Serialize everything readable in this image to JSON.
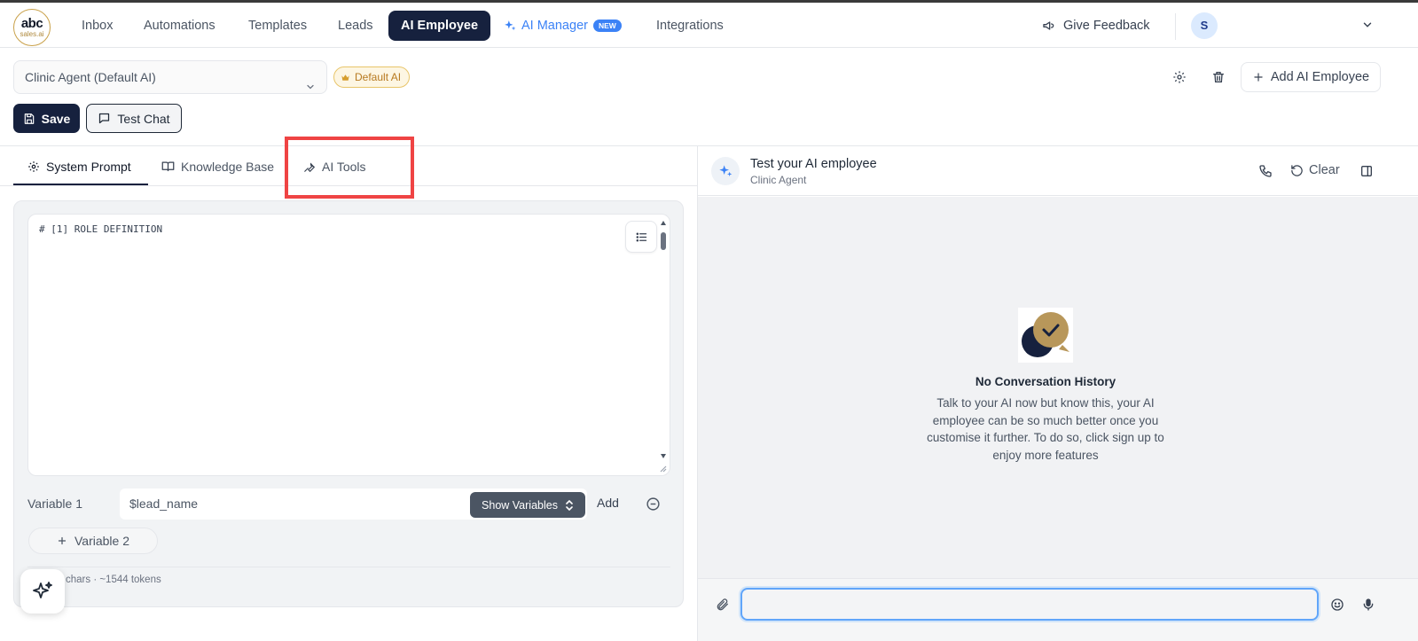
{
  "logo": {
    "main": "abc",
    "sub": "sales.ai"
  },
  "nav": {
    "items": [
      "Inbox",
      "Automations",
      "Templates",
      "Leads",
      "AI Employee",
      "AI Manager",
      "Integrations"
    ],
    "active": "AI Employee",
    "new_badge": "NEW",
    "feedback": "Give Feedback",
    "avatar_initial": "S"
  },
  "toolbar": {
    "agent_select_value": "Clinic Agent (Default AI)",
    "default_badge": "Default AI",
    "add_employee": "Add AI Employee",
    "save": "Save",
    "test_chat": "Test Chat"
  },
  "tabs": [
    {
      "label": "System Prompt",
      "active": true
    },
    {
      "label": "Knowledge Base",
      "active": false
    },
    {
      "label": "AI Tools",
      "active": false
    }
  ],
  "editor": {
    "first_line": "# [1] ROLE DEFINITION"
  },
  "variables": {
    "label": "Variable 1",
    "value": "$lead_name",
    "show_variables": "Show Variables",
    "add": "Add",
    "add_variable": "Variable 2"
  },
  "stats": {
    "text": "chars · ~1544 tokens"
  },
  "chat": {
    "title": "Test your AI employee",
    "subtitle": "Clinic Agent",
    "clear": "Clear",
    "empty_title": "No Conversation History",
    "empty_desc": "Talk to your AI now but know this, your AI employee can be so much better once you customise it further. To do so, click sign up to enjoy more features",
    "input_value": ""
  },
  "colors": {
    "primary": "#16213e",
    "accent_blue": "#3b82f6",
    "gold": "#c9a14a",
    "highlight_red": "#ef4444"
  }
}
